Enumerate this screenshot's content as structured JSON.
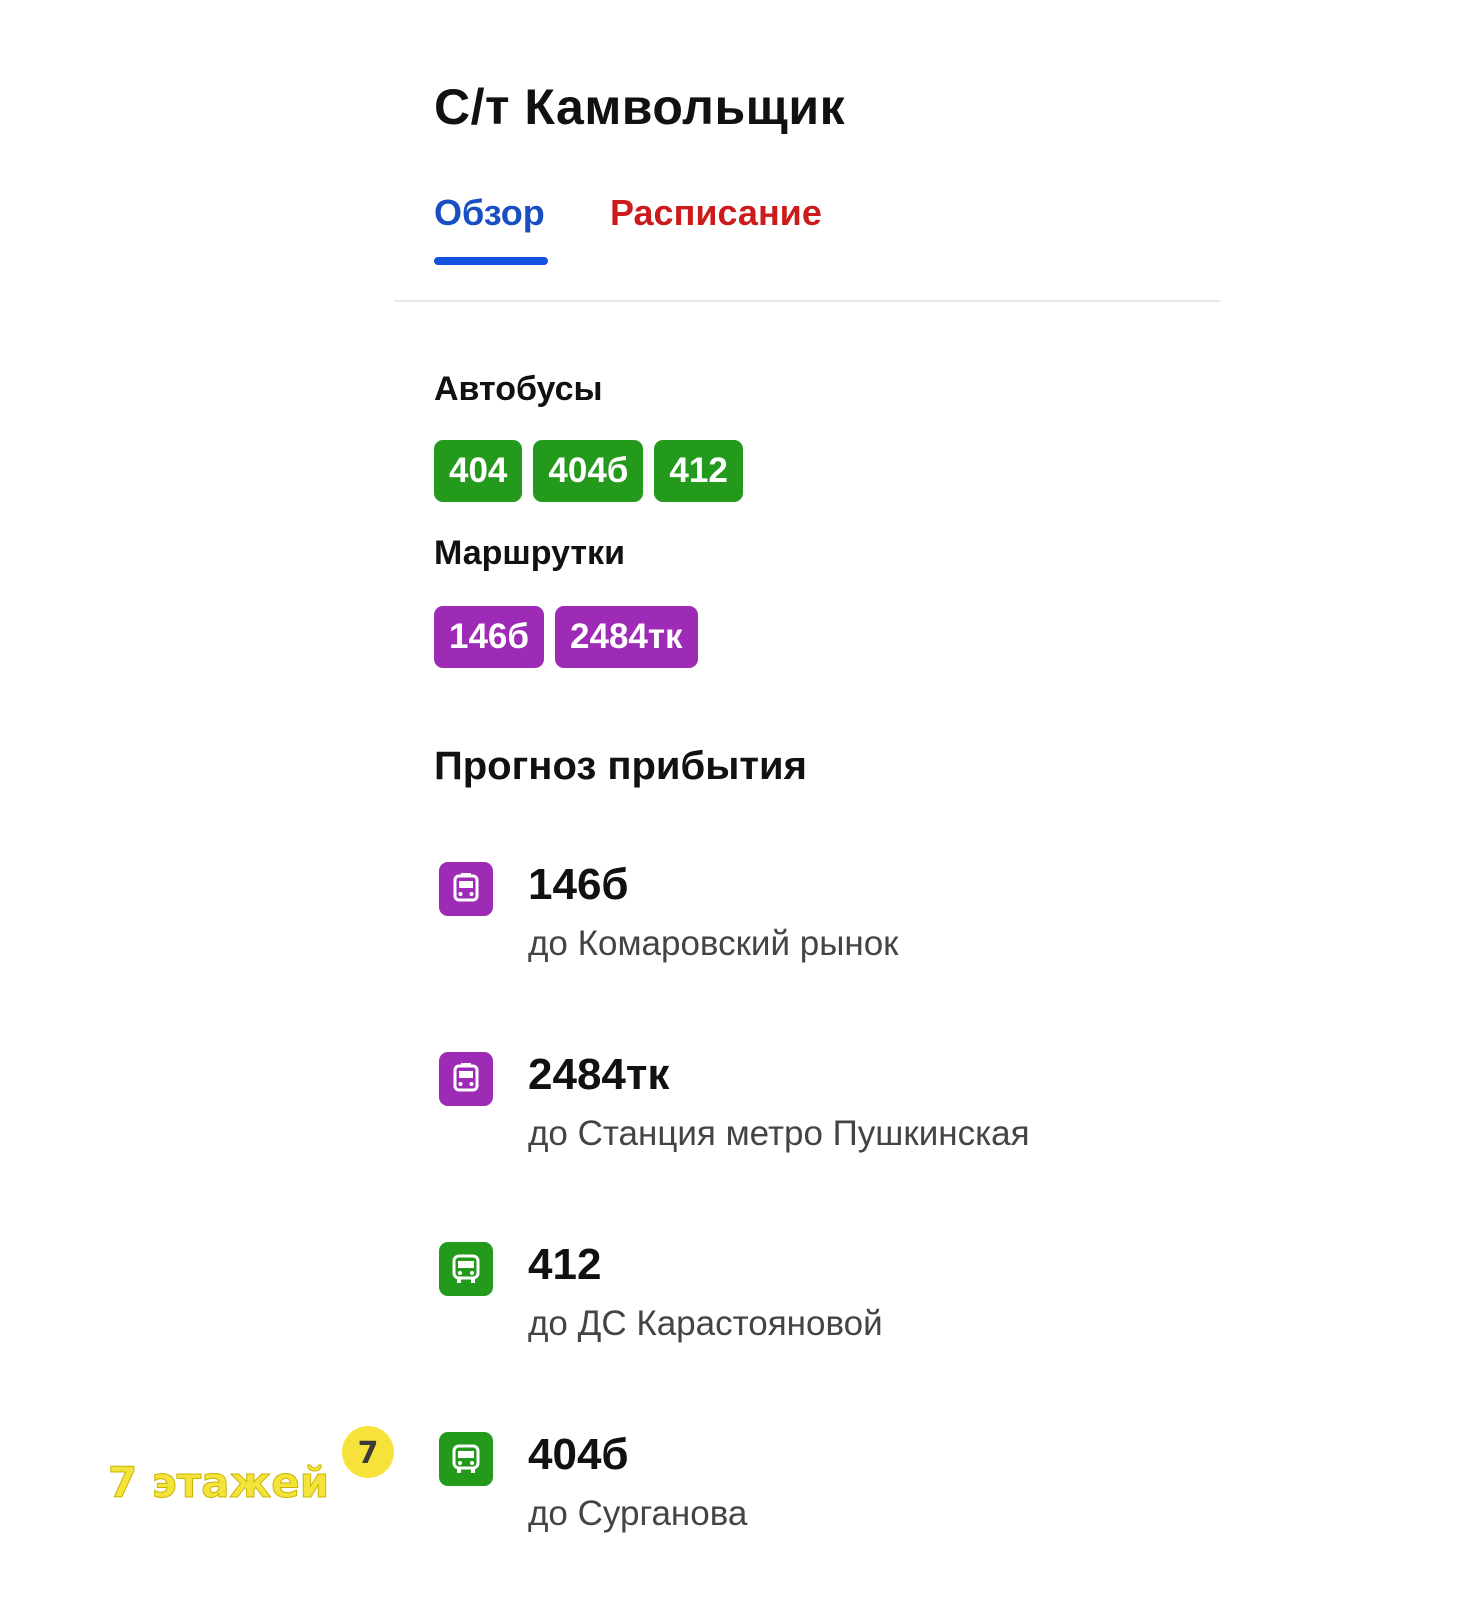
{
  "stop": {
    "title": "С/т Камвольщик"
  },
  "tabs": [
    {
      "label": "Обзор",
      "active": true,
      "color": "#1a4fc4"
    },
    {
      "label": "Расписание",
      "active": false,
      "color": "#cc1b1b"
    }
  ],
  "routes": {
    "buses_label": "Автобусы",
    "buses": [
      "404",
      "404б",
      "412"
    ],
    "minibuses_label": "Маршрутки",
    "minibuses": [
      "146б",
      "2484тк"
    ]
  },
  "forecast": {
    "title": "Прогноз прибытия",
    "items": [
      {
        "number": "146б",
        "destination": "до Комаровский рынок",
        "type": "minibus",
        "icon": "minibus-icon"
      },
      {
        "number": "2484тк",
        "destination": "до Станция метро Пушкинская",
        "type": "minibus",
        "icon": "minibus-icon"
      },
      {
        "number": "412",
        "destination": "до ДС Карастояновой",
        "type": "bus",
        "icon": "bus-icon"
      },
      {
        "number": "404б",
        "destination": "до Сурганова",
        "type": "bus",
        "icon": "bus-icon"
      }
    ]
  },
  "colors": {
    "bus": "#239a1b",
    "minibus": "#9d2bb6",
    "accent": "#1551e0"
  },
  "watermark": {
    "text": "7 этажей",
    "badge": "7"
  }
}
